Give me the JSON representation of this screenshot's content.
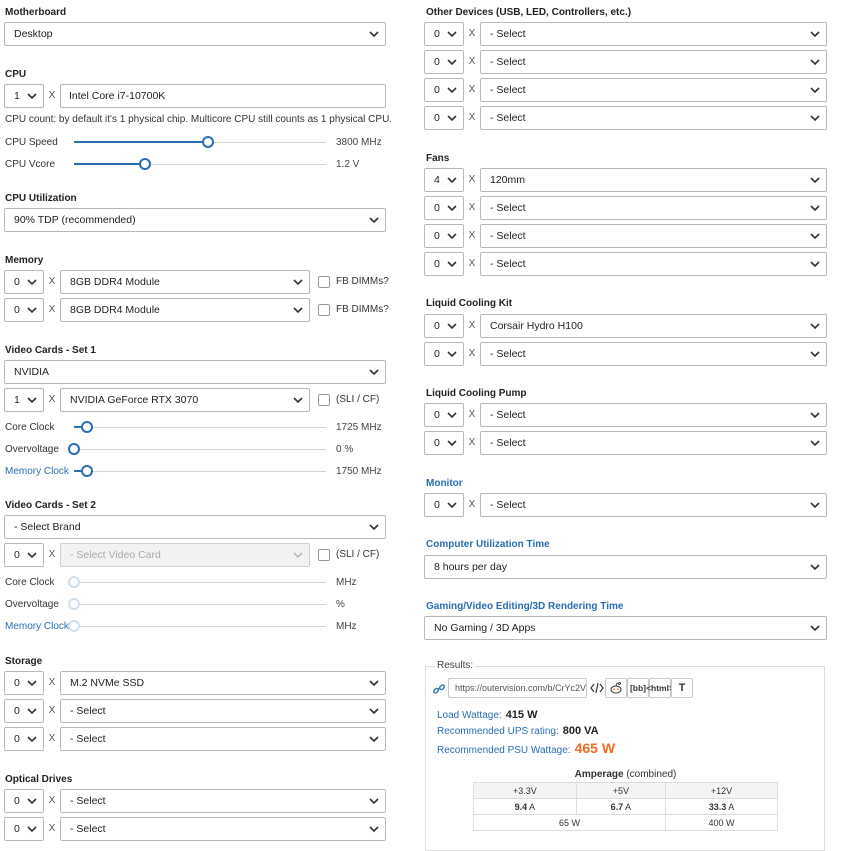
{
  "motherboard": {
    "label": "Motherboard",
    "value": "Desktop"
  },
  "cpu": {
    "label": "CPU",
    "count": "1",
    "x": "X",
    "model": "Intel Core i7-10700K",
    "note": "CPU count: by default it's 1 physical chip. Multicore CPU still counts as 1 physical CPU.",
    "speed_label": "CPU Speed",
    "speed_value": "3800 MHz",
    "speed_level": 0.53,
    "vcore_label": "CPU Vcore",
    "vcore_value": "1.2 V",
    "vcore_level": 0.28
  },
  "cpu_util": {
    "label": "CPU Utilization",
    "value": "90% TDP (recommended)"
  },
  "memory": {
    "label": "Memory",
    "rows": [
      {
        "count": "0",
        "x": "X",
        "module": "8GB DDR4 Module",
        "check_label": "FB DIMMs?"
      },
      {
        "count": "0",
        "x": "X",
        "module": "8GB DDR4 Module",
        "check_label": "FB DIMMs?"
      }
    ]
  },
  "vc1": {
    "label": "Video Cards - Set 1",
    "brand": "NVIDIA",
    "count": "1",
    "x": "X",
    "card": "NVIDIA GeForce RTX 3070",
    "sli_label": "(SLI / CF)",
    "core_label": "Core Clock",
    "core_value": "1725 MHz",
    "core_level": 0.05,
    "ov_label": "Overvoltage",
    "ov_value": "0 %",
    "ov_level": 0.0,
    "mem_label": "Memory Clock",
    "mem_value": "1750 MHz",
    "mem_level": 0.05
  },
  "vc2": {
    "label": "Video Cards - Set 2",
    "brand": "- Select Brand",
    "count": "0",
    "x": "X",
    "card": "- Select Video Card",
    "sli_label": "(SLI / CF)",
    "core_label": "Core Clock",
    "core_value": "MHz",
    "ov_label": "Overvoltage",
    "ov_value": "%",
    "mem_label": "Memory Clock",
    "mem_value": "MHz"
  },
  "storage": {
    "label": "Storage",
    "rows": [
      {
        "count": "0",
        "x": "X",
        "value": "M.2 NVMe SSD"
      },
      {
        "count": "0",
        "x": "X",
        "value": "- Select"
      },
      {
        "count": "0",
        "x": "X",
        "value": "- Select"
      }
    ]
  },
  "optical": {
    "label": "Optical Drives",
    "rows": [
      {
        "count": "0",
        "x": "X",
        "value": "- Select"
      },
      {
        "count": "0",
        "x": "X",
        "value": "- Select"
      }
    ]
  },
  "other": {
    "label": "Other Devices (USB, LED, Controllers, etc.)",
    "rows": [
      {
        "count": "0",
        "x": "X",
        "value": "- Select"
      },
      {
        "count": "0",
        "x": "X",
        "value": "- Select"
      },
      {
        "count": "0",
        "x": "X",
        "value": "- Select"
      },
      {
        "count": "0",
        "x": "X",
        "value": "- Select"
      }
    ]
  },
  "fans": {
    "label": "Fans",
    "rows": [
      {
        "count": "4",
        "x": "X",
        "value": "120mm"
      },
      {
        "count": "0",
        "x": "X",
        "value": "- Select"
      },
      {
        "count": "0",
        "x": "X",
        "value": "- Select"
      },
      {
        "count": "0",
        "x": "X",
        "value": "- Select"
      }
    ]
  },
  "liquid_kit": {
    "label": "Liquid Cooling Kit",
    "rows": [
      {
        "count": "0",
        "x": "X",
        "value": "Corsair Hydro H100"
      },
      {
        "count": "0",
        "x": "X",
        "value": "- Select"
      }
    ]
  },
  "liquid_pump": {
    "label": "Liquid Cooling Pump",
    "rows": [
      {
        "count": "0",
        "x": "X",
        "value": "- Select"
      },
      {
        "count": "0",
        "x": "X",
        "value": "- Select"
      }
    ]
  },
  "monitor": {
    "label": "Monitor",
    "count": "0",
    "x": "X",
    "value": "- Select"
  },
  "util_time": {
    "label": "Computer Utilization Time",
    "value": "8 hours per day"
  },
  "gaming_time": {
    "label": "Gaming/Video Editing/3D Rendering Time",
    "value": "No Gaming / 3D Apps"
  },
  "results": {
    "label": "Results:",
    "url": "https://outervision.com/b/CrYc2V",
    "share": {
      "bb": "[bb]",
      "html": "<html>",
      "t": "T"
    },
    "load_label": "Load Wattage:",
    "load_value": "415 W",
    "ups_label": "Recommended UPS rating:",
    "ups_value": "800 VA",
    "psu_label": "Recommended PSU Wattage:",
    "psu_value": "465 W",
    "amperage_title": "Amperage",
    "amperage_sub": "(combined)",
    "rails": [
      {
        "name": "+3.3V",
        "amp": "9.4",
        "unit": "A"
      },
      {
        "name": "+5V",
        "amp": "6.7",
        "unit": "A"
      },
      {
        "name": "+12V",
        "amp": "33.3",
        "unit": "A"
      }
    ],
    "watts_low": "65 W",
    "watts_12v": "400 W"
  }
}
